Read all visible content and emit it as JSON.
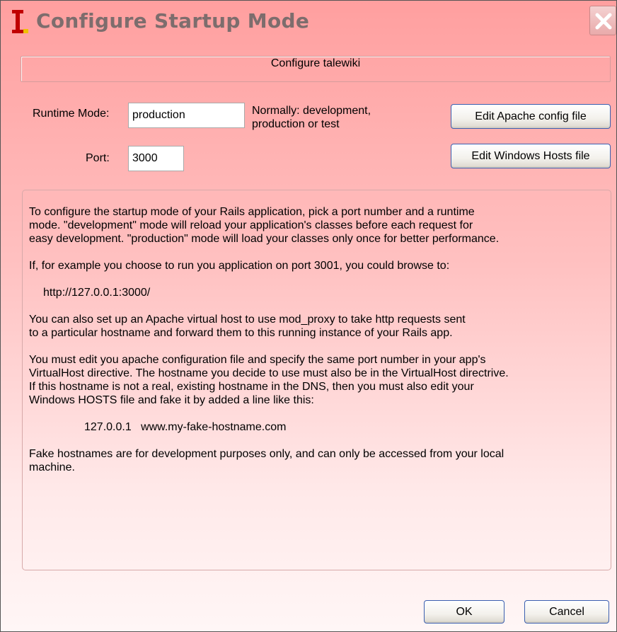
{
  "window": {
    "title": "Configure Startup Mode",
    "logo_letter": "I",
    "logo_icon": "app-logo-icon",
    "close_icon": "close-icon"
  },
  "header": {
    "group_title": "Configure talewiki"
  },
  "form": {
    "runtime_mode_label": "Runtime Mode:",
    "runtime_mode_value": "production",
    "runtime_mode_hint_line1": "Normally: development,",
    "runtime_mode_hint_line2": "production or test",
    "port_label": "Port:",
    "port_value": "3000"
  },
  "buttons": {
    "edit_apache": "Edit Apache config file",
    "edit_hosts": "Edit Windows Hosts file",
    "ok": "OK",
    "cancel": "Cancel"
  },
  "info": {
    "p1_line1": "To configure the startup mode of your Rails application, pick a port number and a runtime",
    "p1_line2": "mode. \"development\" mode will reload your application's classes before each request for",
    "p1_line3": "easy development. \"production\" mode will load your classes only once for better performance.",
    "p2": "If, for example you choose to run you application on port 3001, you could browse to:",
    "url": "http://127.0.0.1:3000/",
    "p3_line1": "You can also set up an Apache virtual host to use mod_proxy to take http requests sent",
    "p3_line2": "to a particular hostname and forward them to this running instance of your Rails app.",
    "p4_line1": "You must edit you apache configuration file and specify the same port number in your app's",
    "p4_line2": "VirtualHost directive. The hostname you decide to use must also be in the VirtualHost directrive.",
    "p4_line3": "If this hostname is not a real, existing hostname in the DNS, then you must also edit your",
    "p4_line4": "Windows HOSTS file and fake it by added a line like this:",
    "hosts_line": "127.0.0.1   www.my-fake-hostname.com",
    "p5_line1": "Fake hostnames are for development purposes only, and can only be accessed from your local",
    "p5_line2": "machine."
  },
  "colors": {
    "background_top": "#ff9f9f",
    "background_bottom": "#fff6f6",
    "title_text": "#7d6d6d",
    "logo_red": "#c00000",
    "logo_yellow": "#f0c000",
    "button_border": "#3a5fb0"
  }
}
